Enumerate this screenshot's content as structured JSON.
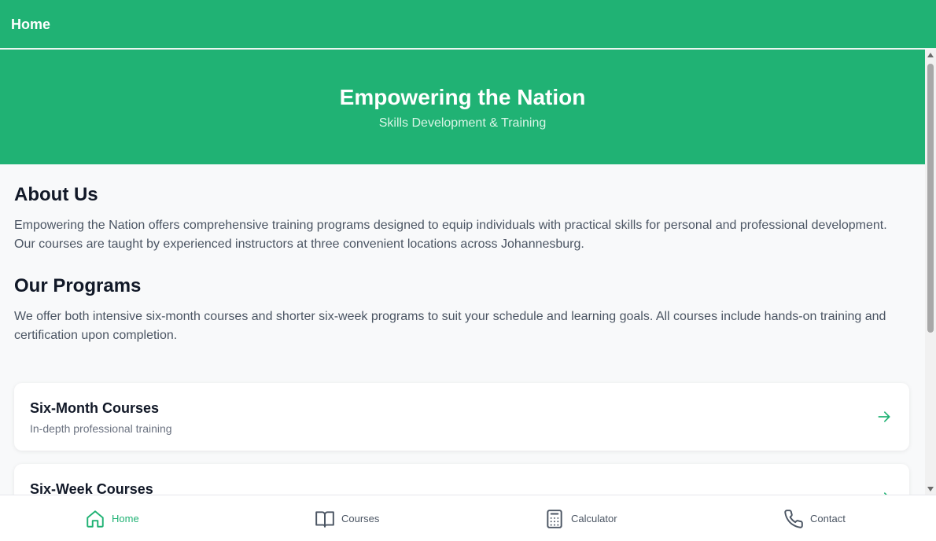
{
  "header": {
    "title": "Home"
  },
  "hero": {
    "title": "Empowering the Nation",
    "subtitle": "Skills Development & Training"
  },
  "about": {
    "title": "About Us",
    "text": "Empowering the Nation offers comprehensive training programs designed to equip individuals with practical skills for personal and professional development. Our courses are taught by experienced instructors at three convenient locations across Johannesburg."
  },
  "programs": {
    "title": "Our Programs",
    "text": "We offer both intensive six-month courses and shorter six-week programs to suit your schedule and learning goals. All courses include hands-on training and certification upon completion."
  },
  "cards": [
    {
      "title": "Six-Month Courses",
      "subtitle": "In-depth professional training",
      "icon": "arrow-right-icon"
    },
    {
      "title": "Six-Week Courses",
      "subtitle": "",
      "icon": "arrow-right-icon"
    }
  ],
  "tabs": [
    {
      "label": "Home",
      "icon": "home-icon",
      "active": true
    },
    {
      "label": "Courses",
      "icon": "book-icon",
      "active": false
    },
    {
      "label": "Calculator",
      "icon": "calculator-icon",
      "active": false
    },
    {
      "label": "Contact",
      "icon": "phone-icon",
      "active": false
    }
  ],
  "colors": {
    "brand": "#20b274",
    "inactive": "#4b5563"
  }
}
